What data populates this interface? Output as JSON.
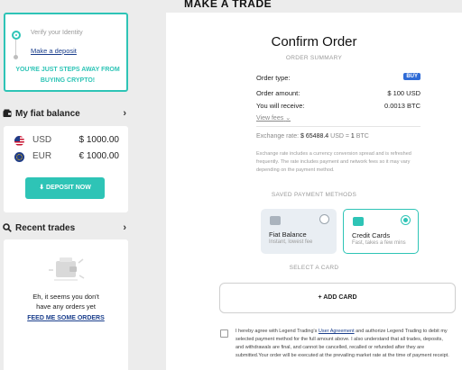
{
  "page": {
    "title": "MAKE A TRADE"
  },
  "steps": {
    "step1": "Verify your Identity",
    "step2": "Make a deposit",
    "message_line1": "YOU'RE JUST STEPS AWAY FROM",
    "message_line2": "BUYING CRYPTO!"
  },
  "fiat_balance": {
    "title": "My fiat balance",
    "rows": [
      {
        "currency": "USD",
        "amount": "$ 1000.00"
      },
      {
        "currency": "EUR",
        "amount": "€ 1000.00"
      }
    ],
    "deposit_label": "DEPOSIT NOW"
  },
  "recent_trades": {
    "title": "Recent trades",
    "empty_line1": "Eh, it seems you don't",
    "empty_line2": "have any orders yet",
    "link": "FEED ME SOME ORDERS"
  },
  "order": {
    "title": "Confirm Order",
    "summary_label": "ORDER SUMMARY",
    "type_label": "Order type:",
    "type_value": "BUY",
    "amount_label": "Order amount:",
    "amount_value": "$ 100 USD",
    "receive_label": "You will receive:",
    "receive_value": "0.0013 BTC",
    "view_fees": "View fees",
    "exchange_label": "Exchange rate:",
    "exchange_value": "$ 65488.4",
    "exchange_mid": "USD =",
    "exchange_btc": "1",
    "exchange_unit": "BTC",
    "exchange_note": "Exchange rate includes a currency conversion spread and is refreshed frequently. The rate includes payment and network fees so it may vary depending on the payment method."
  },
  "payment": {
    "saved_label": "SAVED PAYMENT METHODS",
    "methods": [
      {
        "name": "Fiat Balance",
        "sub": "Instant, lowest fee"
      },
      {
        "name": "Credit Cards",
        "sub": "Fast, takes a few mins"
      }
    ],
    "select_label": "SELECT A CARD",
    "add_card": "+ ADD CARD"
  },
  "agreement": {
    "prefix": "I hereby agree with Legend Trading's ",
    "link": "User Agreement",
    "suffix": " and authorize Legend Trading to debit my selected payment method for the full amount above. I also understand that all trades, deposits, and withdrawals are final, and cannot be cancelled, recalled or refunded after they are submitted.Your order will be executed at the prevailing market rate at the time of payment receipt."
  },
  "colors": {
    "accent": "#2ec4b6",
    "link": "#1a3e8c",
    "buy_badge": "#2f6bd6"
  }
}
